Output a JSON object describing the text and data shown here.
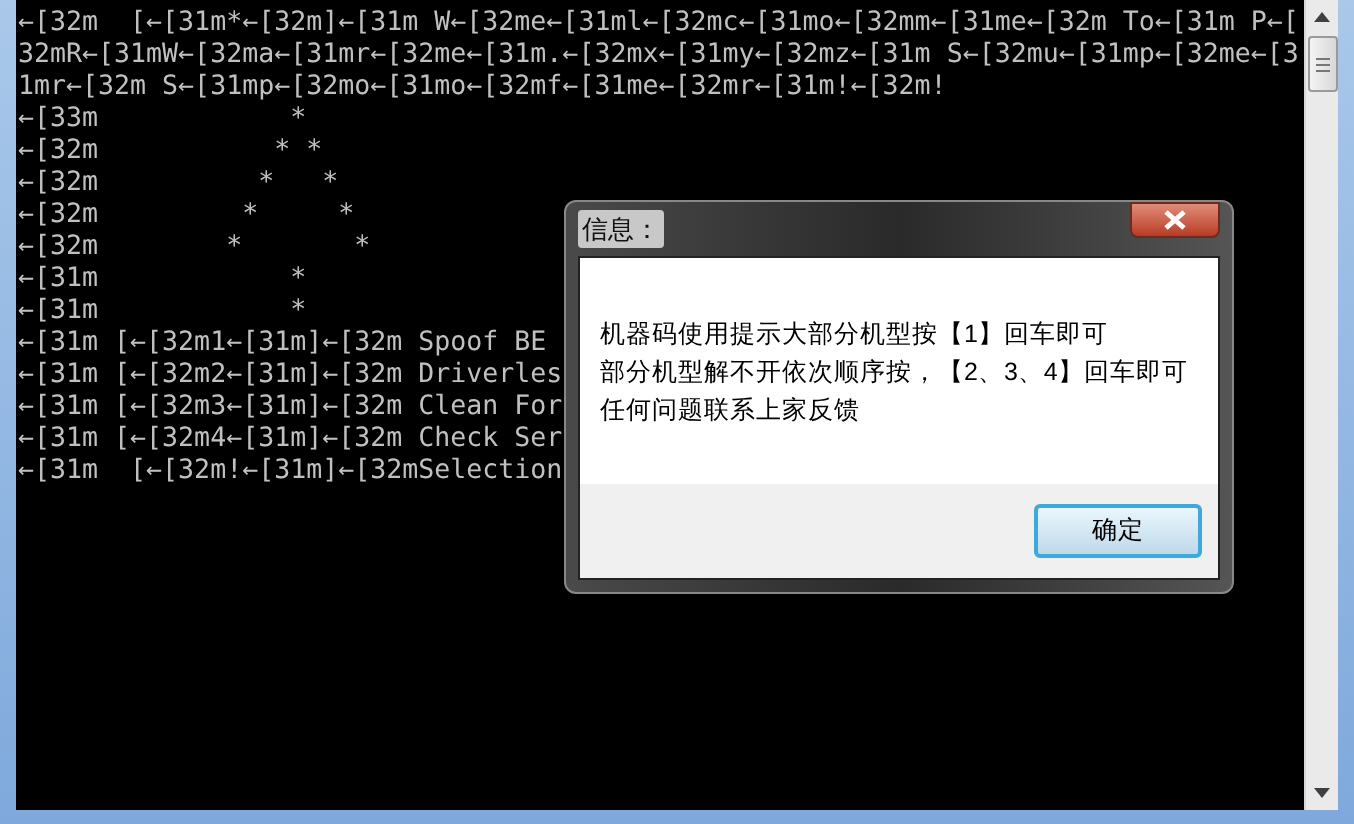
{
  "console": {
    "lines": [
      "←[32m  [←[31m*←[32m]←[31m W←[32me←[31ml←[32mc←[31mo←[32mm←[31me←[32m To←[31m P←[",
      "32mR←[31mW←[32ma←[31mr←[32me←[31m.←[32mx←[31my←[32mz←[31m S←[32mu←[31mp←[32me←[3",
      "1mr←[32m S←[31mp←[32mo←[31mo←[32mf←[31me←[32mr←[31m!←[32m!",
      "←[33m            *",
      "←[32m           * *",
      "←[32m          *   *",
      "←[32m         *     *",
      "←[32m        *       *",
      "←[31m            *",
      "←[31m            *",
      "←[31m [←[32m1←[31m]←[32m Spoof BE",
      "←[31m [←[32m2←[31m]←[32m Driverles",
      "←[31m [←[32m3←[31m]←[32m Clean For",
      "←[31m [←[32m4←[31m]←[32m Check Ser",
      "←[31m  [←[32m!←[31m]←[32mSelection"
    ]
  },
  "dialog": {
    "title": "信息：",
    "message": [
      "机器码使用提示大部分机型按【1】回车即可",
      "部分机型解不开依次顺序按，【2、3、4】回车即可",
      "任何问题联系上家反馈"
    ],
    "buttons": [
      {
        "label": "确定",
        "default": true
      }
    ]
  }
}
